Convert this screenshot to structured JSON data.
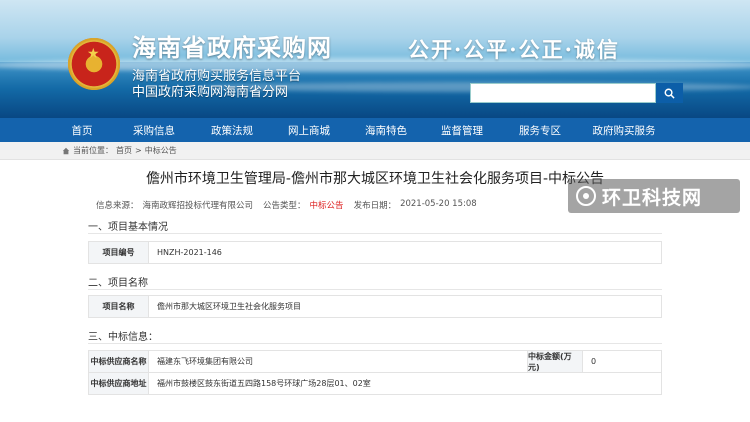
{
  "header": {
    "title": "海南省政府采购网",
    "subtitle1": "海南省政府购买服务信息平台",
    "subtitle2": "中国政府采购网海南省分网",
    "slogan": "公开·公平·公正·诚信",
    "search": {
      "placeholder": ""
    }
  },
  "nav": {
    "items": [
      "首页",
      "采购信息",
      "政策法规",
      "网上商城",
      "海南特色",
      "监督管理",
      "服务专区",
      "政府购买服务"
    ]
  },
  "breadcrumb": {
    "prefix": "当前位置：",
    "home": "首页",
    "sep": ">",
    "current": "中标公告"
  },
  "article": {
    "title": "儋州市环境卫生管理局-儋州市那大城区环境卫生社会化服务项目-中标公告",
    "meta": {
      "source_label": "信息来源：",
      "source": "海南政辉招投标代理有限公司",
      "type_label": "公告类型：",
      "type": "中标公告",
      "date_label": "发布日期：",
      "date": "2021-05-20 15:08"
    },
    "sections": [
      {
        "heading": "一、项目基本情况",
        "label": "项目编号",
        "value": "HNZH-2021-146"
      },
      {
        "heading": "二、项目名称",
        "label": "项目名称",
        "value": "儋州市那大城区环境卫生社会化服务项目"
      },
      {
        "heading": "三、中标信息："
      }
    ],
    "winner": {
      "supplier_label": "中标供应商名称",
      "supplier": "福建东飞环境集团有限公司",
      "amount_label": "中标金额(万元)",
      "amount": "0",
      "address_label": "中标供应商地址",
      "address": "福州市鼓楼区鼓东街道五四路158号环球广场28层01、02室"
    }
  },
  "watermark": {
    "text": "环卫科技网"
  },
  "colors": {
    "nav": "#1463ad",
    "accent_red": "#d22222"
  }
}
